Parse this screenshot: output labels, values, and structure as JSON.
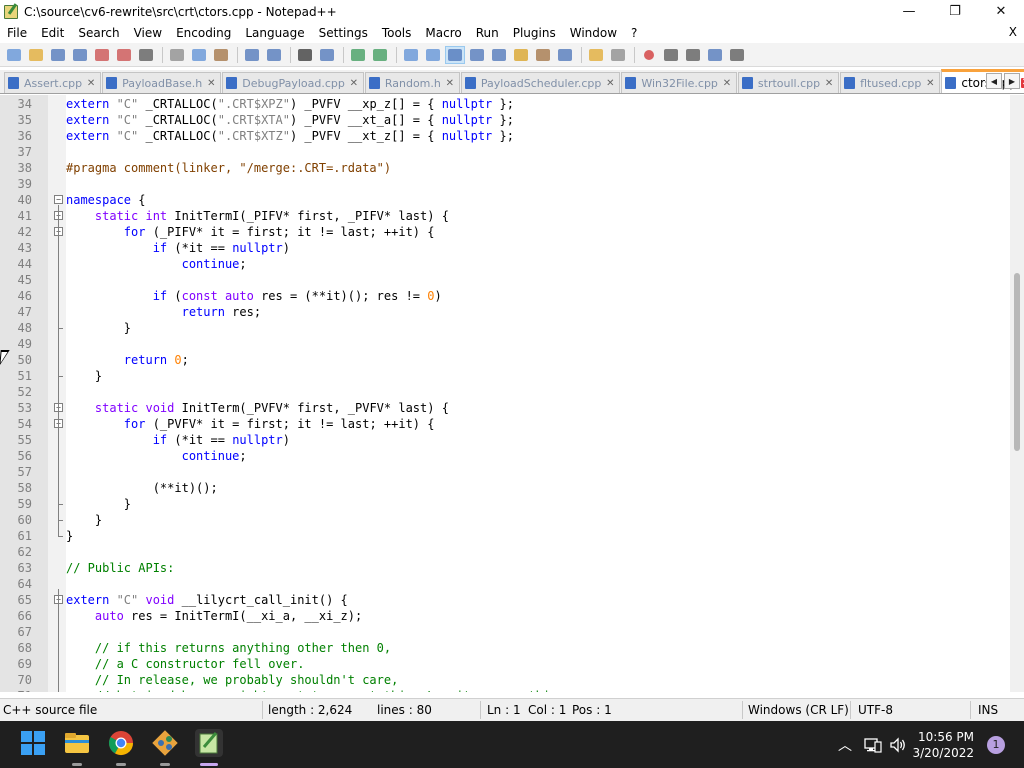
{
  "window": {
    "title": "C:\\source\\cv6-rewrite\\src\\crt\\ctors.cpp - Notepad++",
    "minimize": "—",
    "maximize": "❐",
    "close": "✕"
  },
  "menu": {
    "items": [
      "File",
      "Edit",
      "Search",
      "View",
      "Encoding",
      "Language",
      "Settings",
      "Tools",
      "Macro",
      "Run",
      "Plugins",
      "Window",
      "?"
    ],
    "close_doc": "X"
  },
  "toolbar": {
    "buttons": [
      "new-file-icon",
      "open-file-icon",
      "save-icon",
      "save-all-icon",
      "close-icon",
      "close-all-icon",
      "print-icon",
      "cut-icon",
      "copy-icon",
      "paste-icon",
      "undo-icon",
      "redo-icon",
      "find-icon",
      "replace-icon",
      "zoom-in-icon",
      "zoom-out-icon",
      "sync-vertical-icon",
      "sync-horizontal-icon",
      "word-wrap-icon",
      "show-all-chars-icon",
      "indent-guide-icon",
      "udl-icon",
      "doc-map-icon",
      "function-list-icon",
      "folder-workspace-icon",
      "monitor-icon",
      "record-macro-icon",
      "stop-macro-icon",
      "play-macro-icon",
      "run-macro-multiple-icon",
      "save-macro-icon"
    ]
  },
  "tabs": [
    {
      "label": "Assert.cpp",
      "active": false
    },
    {
      "label": "PayloadBase.h",
      "active": false
    },
    {
      "label": "DebugPayload.cpp",
      "active": false
    },
    {
      "label": "Random.h",
      "active": false
    },
    {
      "label": "PayloadScheduler.cpp",
      "active": false
    },
    {
      "label": "Win32File.cpp",
      "active": false
    },
    {
      "label": "strtoull.cpp",
      "active": false
    },
    {
      "label": "fltused.cpp",
      "active": false
    },
    {
      "label": "ctors.cpp",
      "active": true
    }
  ],
  "tab_close": "✕",
  "tab_nav": {
    "left": "◀",
    "right": "▶"
  },
  "editor": {
    "lines": [
      {
        "n": "34",
        "code": [
          [
            "extern ",
            "k"
          ],
          [
            "\"C\" ",
            "s"
          ],
          [
            "_CRTALLOC(",
            "p"
          ],
          [
            "\".CRT$XPZ\"",
            "s"
          ],
          [
            ") _PVFV __xp_z[] = { ",
            "p"
          ],
          [
            "nullptr",
            "k"
          ],
          [
            " };",
            "p"
          ]
        ]
      },
      {
        "n": "35",
        "code": [
          [
            "extern ",
            "k"
          ],
          [
            "\"C\" ",
            "s"
          ],
          [
            "_CRTALLOC(",
            "p"
          ],
          [
            "\".CRT$XTA\"",
            "s"
          ],
          [
            ") _PVFV __xt_a[] = { ",
            "p"
          ],
          [
            "nullptr",
            "k"
          ],
          [
            " };",
            "p"
          ]
        ]
      },
      {
        "n": "36",
        "code": [
          [
            "extern ",
            "k"
          ],
          [
            "\"C\" ",
            "s"
          ],
          [
            "_CRTALLOC(",
            "p"
          ],
          [
            "\".CRT$XTZ\"",
            "s"
          ],
          [
            ") _PVFV __xt_z[] = { ",
            "p"
          ],
          [
            "nullptr",
            "k"
          ],
          [
            " };",
            "p"
          ]
        ]
      },
      {
        "n": "37",
        "code": []
      },
      {
        "n": "38",
        "code": [
          [
            "#pragma comment(linker, \"/merge:.CRT=.rdata\")",
            "pp"
          ]
        ]
      },
      {
        "n": "39",
        "code": []
      },
      {
        "n": "40",
        "code": [
          [
            "namespace",
            "k"
          ],
          [
            " {",
            "p"
          ]
        ],
        "fold": "minus"
      },
      {
        "n": "41",
        "code": [
          [
            "    ",
            "p"
          ],
          [
            "static int",
            "t"
          ],
          [
            " InitTermI(_PIFV* first, _PIFV* last) {",
            "p"
          ]
        ],
        "fold": "minus"
      },
      {
        "n": "42",
        "code": [
          [
            "        ",
            "p"
          ],
          [
            "for",
            "k"
          ],
          [
            " (_PIFV* it = first; it != last; ++it) {",
            "p"
          ]
        ],
        "fold": "minus"
      },
      {
        "n": "43",
        "code": [
          [
            "            ",
            "p"
          ],
          [
            "if",
            "k"
          ],
          [
            " (*it == ",
            "p"
          ],
          [
            "nullptr",
            "k"
          ],
          [
            ")",
            "p"
          ]
        ]
      },
      {
        "n": "44",
        "code": [
          [
            "                ",
            "p"
          ],
          [
            "continue",
            "k"
          ],
          [
            ";",
            "p"
          ]
        ]
      },
      {
        "n": "45",
        "code": []
      },
      {
        "n": "46",
        "code": [
          [
            "            ",
            "p"
          ],
          [
            "if",
            "k"
          ],
          [
            " (",
            "p"
          ],
          [
            "const auto",
            "t"
          ],
          [
            " res = (**it)(); res != ",
            "p"
          ],
          [
            "0",
            "n"
          ],
          [
            ")",
            "p"
          ]
        ]
      },
      {
        "n": "47",
        "code": [
          [
            "                ",
            "p"
          ],
          [
            "return",
            "k"
          ],
          [
            " res;",
            "p"
          ]
        ]
      },
      {
        "n": "48",
        "code": [
          [
            "        }",
            "p"
          ]
        ],
        "fold": "end"
      },
      {
        "n": "49",
        "code": []
      },
      {
        "n": "50",
        "code": [
          [
            "        ",
            "p"
          ],
          [
            "return",
            "k"
          ],
          [
            " ",
            "p"
          ],
          [
            "0",
            "n"
          ],
          [
            ";",
            "p"
          ]
        ]
      },
      {
        "n": "51",
        "code": [
          [
            "    }",
            "p"
          ]
        ],
        "fold": "end"
      },
      {
        "n": "52",
        "code": []
      },
      {
        "n": "53",
        "code": [
          [
            "    ",
            "p"
          ],
          [
            "static void",
            "t"
          ],
          [
            " InitTerm(_PVFV* first, _PVFV* last) {",
            "p"
          ]
        ],
        "fold": "minus"
      },
      {
        "n": "54",
        "code": [
          [
            "        ",
            "p"
          ],
          [
            "for",
            "k"
          ],
          [
            " (_PVFV* it = first; it != last; ++it) {",
            "p"
          ]
        ],
        "fold": "minus"
      },
      {
        "n": "55",
        "code": [
          [
            "            ",
            "p"
          ],
          [
            "if",
            "k"
          ],
          [
            " (*it == ",
            "p"
          ],
          [
            "nullptr",
            "k"
          ],
          [
            ")",
            "p"
          ]
        ]
      },
      {
        "n": "56",
        "code": [
          [
            "                ",
            "p"
          ],
          [
            "continue",
            "k"
          ],
          [
            ";",
            "p"
          ]
        ]
      },
      {
        "n": "57",
        "code": []
      },
      {
        "n": "58",
        "code": [
          [
            "            (**it)();",
            "p"
          ]
        ]
      },
      {
        "n": "59",
        "code": [
          [
            "        }",
            "p"
          ]
        ],
        "fold": "end"
      },
      {
        "n": "60",
        "code": [
          [
            "    }",
            "p"
          ]
        ],
        "fold": "end"
      },
      {
        "n": "61",
        "code": [
          [
            "}",
            "p"
          ]
        ],
        "fold": "end"
      },
      {
        "n": "62",
        "code": []
      },
      {
        "n": "63",
        "code": [
          [
            "// Public APIs:",
            "c"
          ]
        ]
      },
      {
        "n": "64",
        "code": []
      },
      {
        "n": "65",
        "code": [
          [
            "extern ",
            "k"
          ],
          [
            "\"C\" ",
            "s"
          ],
          [
            "void",
            "t"
          ],
          [
            " __lilycrt_call_init() {",
            "p"
          ]
        ],
        "fold": "minus"
      },
      {
        "n": "66",
        "code": [
          [
            "    ",
            "p"
          ],
          [
            "auto",
            "t"
          ],
          [
            " res = InitTermI(__xi_a, __xi_z);",
            "p"
          ]
        ]
      },
      {
        "n": "67",
        "code": []
      },
      {
        "n": "68",
        "code": [
          [
            "    // if this returns anything other then 0,",
            "c"
          ]
        ]
      },
      {
        "n": "69",
        "code": [
          [
            "    // a C constructor fell over.",
            "c"
          ]
        ]
      },
      {
        "n": "70",
        "code": [
          [
            "    // In release, we probably shouldn't care,",
            "c"
          ]
        ]
      },
      {
        "n": "71",
        "code": [
          [
            "    // but in debug we might want to report this. Log it or something.",
            "c"
          ]
        ]
      }
    ]
  },
  "status": {
    "language": "C++ source file",
    "length": "length : 2,624",
    "lines": "lines : 80",
    "ln": "Ln : 1",
    "col": "Col : 1",
    "pos": "Pos : 1",
    "eol": "Windows (CR LF)",
    "encoding": "UTF-8",
    "mode": "INS"
  },
  "taskbar": {
    "time": "10:56 PM",
    "date": "3/20/2022",
    "notifications": "1",
    "chevron": "︿"
  },
  "colors": {
    "keyword": "#0000ff",
    "type": "#8000ff",
    "string": "#808080",
    "comment": "#008000",
    "number": "#ff8000",
    "preprocessor": "#804000",
    "active_tab_accent": "#f9a23c"
  }
}
